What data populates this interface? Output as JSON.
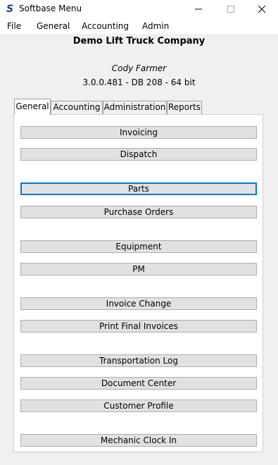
{
  "window": {
    "title": "Softbase Menu",
    "app_icon_letter": "S"
  },
  "menubar": {
    "items": [
      "File",
      "General",
      "Accounting",
      "Admin"
    ]
  },
  "header": {
    "company": "Demo Lift Truck Company",
    "user": "Cody Farmer",
    "version": "3.0.0.481 - DB 208 - 64 bit"
  },
  "tabs": [
    {
      "label": "General",
      "active": true
    },
    {
      "label": "Accounting",
      "active": false
    },
    {
      "label": "Administration",
      "active": false
    },
    {
      "label": "Reports",
      "active": false
    }
  ],
  "buttons": [
    {
      "label": "Invoicing"
    },
    {
      "label": "Dispatch"
    },
    {
      "label": "Parts",
      "focused": true
    },
    {
      "label": "Purchase Orders"
    },
    {
      "label": "Equipment"
    },
    {
      "label": "PM"
    },
    {
      "label": "Invoice Change"
    },
    {
      "label": "Print Final Invoices"
    },
    {
      "label": "Transportation Log"
    },
    {
      "label": "Document Center"
    },
    {
      "label": "Customer Profile"
    },
    {
      "label": "Mechanic Clock In"
    }
  ],
  "colors": {
    "focus_border": "#0078d7",
    "button_face": "#e1e1e1",
    "window_bg": "#f0f0f0"
  }
}
